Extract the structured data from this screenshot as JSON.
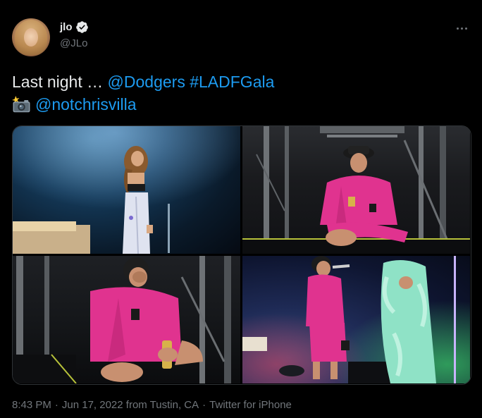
{
  "author": {
    "display_name": "jlo",
    "handle": "@JLo",
    "verified": true
  },
  "tweet": {
    "text_prefix": "Last night … ",
    "mention_1": "@Dodgers",
    "hashtag": "#LADFGala",
    "camera_emoji": "camera-flash-icon",
    "mention_2": "@notchrisvilla"
  },
  "media": {
    "photos": [
      {
        "description_icon": "photo-performer-stage"
      },
      {
        "description_icon": "photo-seated-pink-suit"
      },
      {
        "description_icon": "photo-seated-laughing"
      },
      {
        "description_icon": "photo-singing-on-stage"
      }
    ]
  },
  "footer": {
    "time": "8:43 PM",
    "separator": "·",
    "date_location": "Jun 17, 2022 from Tustin, CA",
    "client": "Twitter for iPhone"
  },
  "colors": {
    "background": "#000000",
    "text": "#e7e9ea",
    "secondary": "#71767b",
    "link": "#1d9bf0",
    "pink_suit": "#e0338f"
  }
}
